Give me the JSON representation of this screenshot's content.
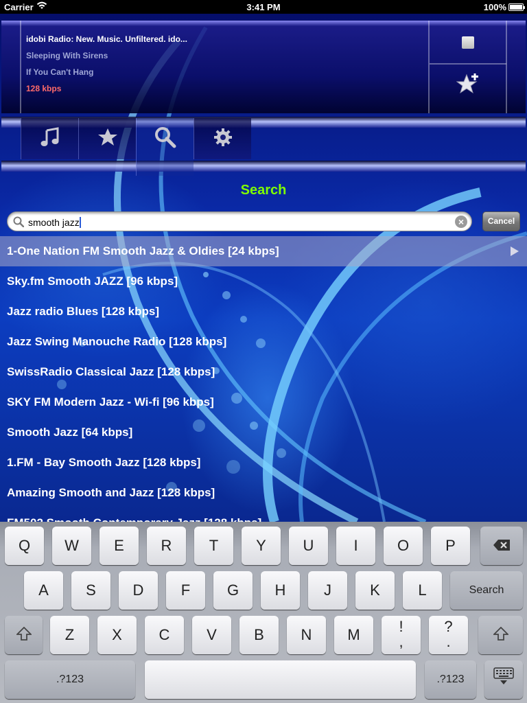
{
  "status_bar": {
    "carrier": "Carrier",
    "time": "3:41 PM",
    "battery": "100%"
  },
  "now_playing": {
    "station": "idobi Radio: New. Music. Unfiltered. ido...",
    "artist": "Sleeping With Sirens",
    "track": "If You Can't Hang",
    "bitrate": "128 kbps",
    "bitrate_color": "#ff6a6a"
  },
  "controls": {
    "stop_icon": "stop-icon",
    "add_favorite_icon": "star-plus-icon"
  },
  "tabs": [
    {
      "name": "now-playing",
      "icon": "music-note-icon",
      "active": false
    },
    {
      "name": "favorites",
      "icon": "star-icon",
      "active": false
    },
    {
      "name": "search",
      "icon": "search-icon",
      "active": true
    },
    {
      "name": "settings",
      "icon": "gear-icon",
      "active": false
    }
  ],
  "page": {
    "title": "Search",
    "title_color": "#7fff00"
  },
  "search": {
    "value": "smooth jazz",
    "cancel_label": "Cancel"
  },
  "results": [
    "1-One Nation FM Smooth Jazz & Oldies [24 kbps]",
    "Sky.fm Smooth JAZZ [96 kbps]",
    "Jazz radio Blues [128 kbps]",
    "Jazz Swing Manouche Radio [128 kbps]",
    "SwissRadio Classical Jazz [128 kbps]",
    "SKY FM Modern Jazz - Wi-fi [96 kbps]",
    "Smooth Jazz [64 kbps]",
    "1.FM - Bay Smooth Jazz [128 kbps]",
    "Amazing Smooth and Jazz [128 kbps]",
    "FM502 Smooth Contemporary Jazz [128 kbps]"
  ],
  "keyboard": {
    "row1": [
      "Q",
      "W",
      "E",
      "R",
      "T",
      "Y",
      "U",
      "I",
      "O",
      "P"
    ],
    "row2": [
      "A",
      "S",
      "D",
      "F",
      "G",
      "H",
      "J",
      "K",
      "L"
    ],
    "row3": [
      "Z",
      "X",
      "C",
      "V",
      "B",
      "N",
      "M",
      "!\n,",
      "?\n."
    ],
    "return_label": "Search",
    "numbers_label": ".?123",
    "backspace_icon": "backspace-icon",
    "shift_icon": "shift-icon",
    "hide_keyboard_icon": "keyboard-hide-icon"
  }
}
